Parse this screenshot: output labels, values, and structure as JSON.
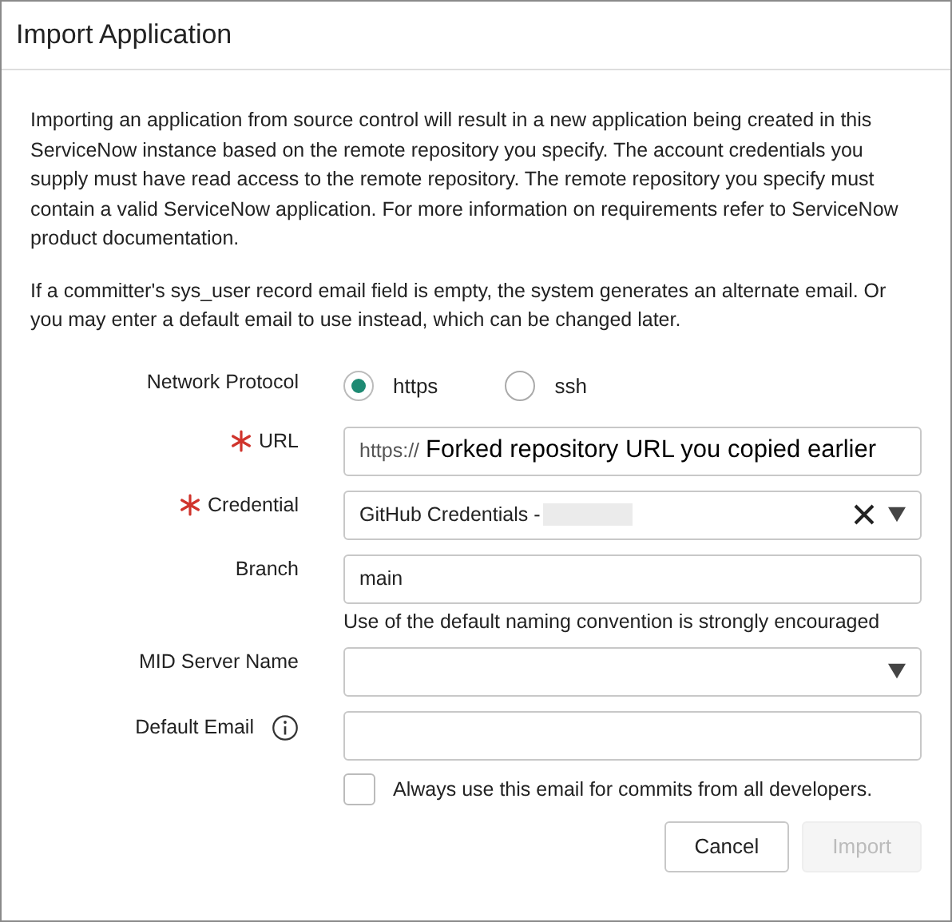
{
  "dialog": {
    "title": "Import Application"
  },
  "description": [
    "Importing an application from source control will result in a new application being created in this ServiceNow instance based on the remote repository you specify. The account credentials you supply must have read access to the remote repository. The remote repository you specify must contain a valid ServiceNow application. For more information on requirements refer to ServiceNow product documentation.",
    "If a committer's sys_user record email field is empty, the system generates an alternate email. Or you may enter a default email to use instead, which can be changed later."
  ],
  "fields": [
    {
      "kind": "radio",
      "label": "Network Protocol",
      "options": [
        {
          "label": "https",
          "selected": true
        },
        {
          "label": "ssh",
          "selected": false
        }
      ]
    },
    {
      "kind": "url",
      "label": "URL",
      "required": true,
      "prefix": "https://",
      "value": "Forked repository URL you copied earlier"
    },
    {
      "kind": "select",
      "label": "Credential",
      "required": true,
      "value": "GitHub Credentials -",
      "redacted": true,
      "clearable": true
    },
    {
      "kind": "text",
      "label": "Branch",
      "value": "main",
      "hint": "Use of the default naming convention is strongly encouraged"
    },
    {
      "kind": "select",
      "label": "MID Server Name"
    },
    {
      "kind": "text",
      "label": "Default Email",
      "info": true,
      "checkbox": {
        "label": "Always use this email for commits from all developers.",
        "checked": false
      }
    }
  ],
  "buttons": [
    {
      "label": "Cancel",
      "disabled": false
    },
    {
      "label": "Import",
      "disabled": true
    }
  ]
}
